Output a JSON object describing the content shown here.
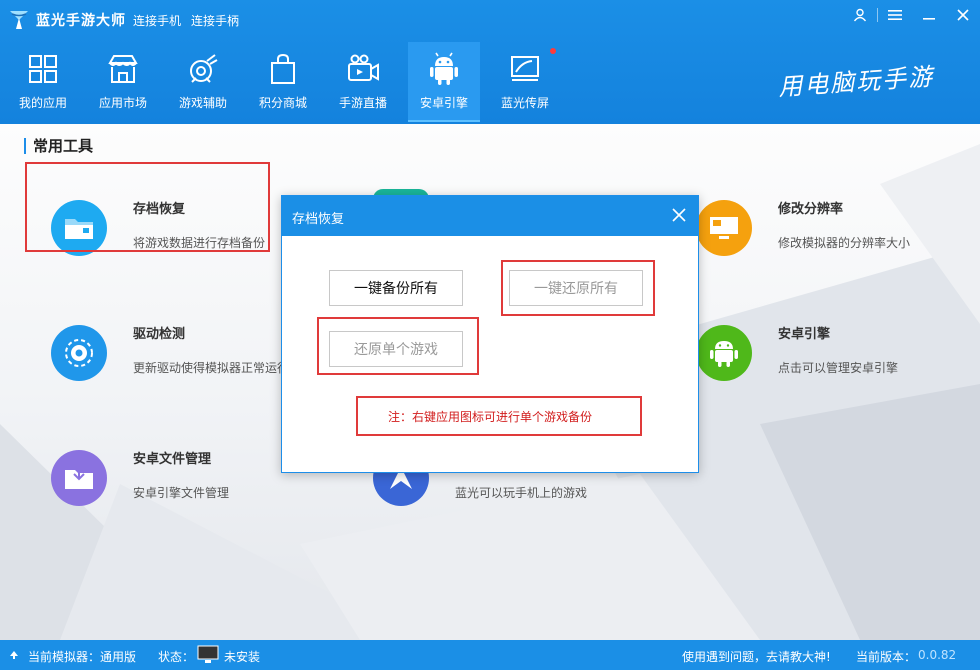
{
  "app": {
    "title": "蓝光手游大师",
    "links": [
      "连接手机",
      "连接手柄"
    ],
    "slogan": "用电脑玩手游"
  },
  "nav": [
    {
      "label": "我的应用",
      "icon": "grid-icon"
    },
    {
      "label": "应用市场",
      "icon": "store-icon"
    },
    {
      "label": "游戏辅助",
      "icon": "game-assist-icon"
    },
    {
      "label": "积分商城",
      "icon": "shopping-bag-icon"
    },
    {
      "label": "手游直播",
      "icon": "video-camera-icon"
    },
    {
      "label": "安卓引擎",
      "icon": "android-icon",
      "active": true
    },
    {
      "label": "蓝光传屏",
      "icon": "screen-cast-icon"
    }
  ],
  "section": {
    "title": "常用工具"
  },
  "tools": [
    {
      "name": "存档恢复",
      "desc": "将游戏数据进行存档备份",
      "icon": "folder-icon",
      "color": "#1eaaf1"
    },
    {
      "name": "修改分辨率",
      "desc": "修改模拟器的分辨率大小",
      "icon": "monitor-icon",
      "color": "#f5a10e"
    },
    {
      "name": "驱动检测",
      "desc": "更新驱动使得模拟器正常运行",
      "icon": "gear-icon",
      "color": "#2097ea"
    },
    {
      "name": "安卓引擎",
      "desc": "点击可以管理安卓引擎",
      "icon": "android-icon",
      "color": "#4fb81a"
    },
    {
      "name": "安卓文件管理",
      "desc": "安卓引擎文件管理",
      "icon": "file-manager-icon",
      "color": "#8a72e0"
    },
    {
      "name": "",
      "desc": "蓝光可以玩手机上的游戏",
      "icon": "phone-game-icon",
      "color": "#3a66d6"
    }
  ],
  "dialog": {
    "title": "存档恢复",
    "buttons": {
      "backup_all": "一键备份所有",
      "restore_all": "一键还原所有",
      "restore_single": "还原单个游戏"
    },
    "note": "注：右键应用图标可进行单个游戏备份"
  },
  "status": {
    "simulator": "当前模拟器：通用版",
    "state_label": "状态：",
    "state_value": "未安装",
    "help": "使用遇到问题，去请教大神!",
    "version_label": "当前版本：",
    "version": "0.0.82"
  },
  "colors": {
    "primary": "#1b8fe6",
    "highlight_red": "#e03a3a",
    "note_red": "#d21e1e"
  }
}
